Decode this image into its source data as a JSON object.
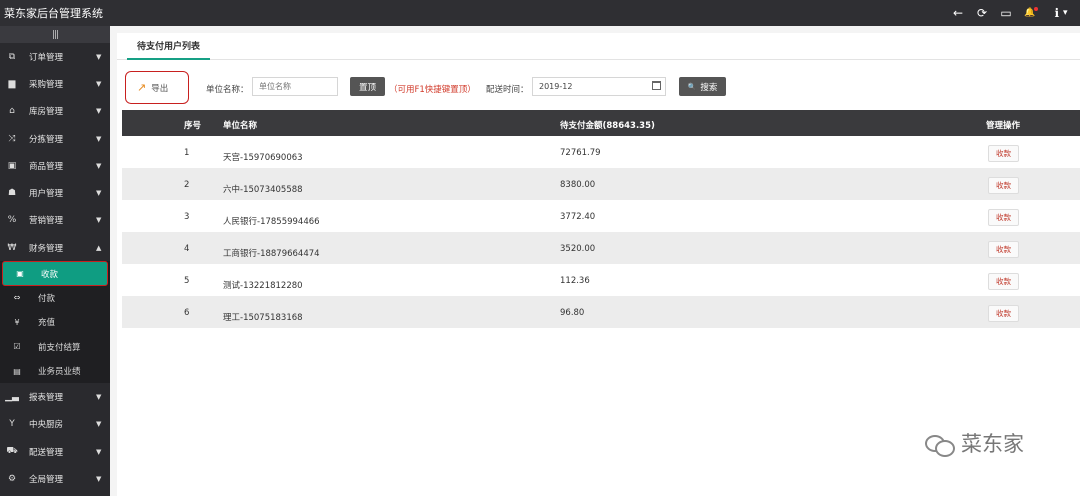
{
  "app": {
    "title": "菜东家后台管理系统"
  },
  "topbar": {
    "icons": [
      "arrow-left-icon",
      "refresh-icon",
      "monitor-icon",
      "bell-icon",
      "info-icon"
    ],
    "glyphs": {
      "back": "←",
      "refresh": "⟳",
      "monitor": "▭",
      "bell": "🔔",
      "info": "ℹ",
      "caret": "▾"
    }
  },
  "sidebar": {
    "toggle": "|||",
    "items": [
      {
        "icon": "copy-icon",
        "glyph": "⧉",
        "label": "订单管理"
      },
      {
        "icon": "basket-icon",
        "glyph": "▆",
        "label": "采购管理"
      },
      {
        "icon": "bank-icon",
        "glyph": "⌂",
        "label": "库房管理"
      },
      {
        "icon": "shuffle-icon",
        "glyph": "⤨",
        "label": "分拣管理"
      },
      {
        "icon": "store-icon",
        "glyph": "▣",
        "label": "商品管理"
      },
      {
        "icon": "users-icon",
        "glyph": "☗",
        "label": "用户管理"
      },
      {
        "icon": "percent-icon",
        "glyph": "%",
        "label": "营销管理"
      },
      {
        "icon": "won-icon",
        "glyph": "₩",
        "label": "财务管理"
      }
    ],
    "finance_sub": [
      {
        "icon": "money-icon",
        "glyph": "▣",
        "label": "收款"
      },
      {
        "icon": "exchange-icon",
        "glyph": "⇔",
        "label": "付款"
      },
      {
        "icon": "yen-icon",
        "glyph": "¥",
        "label": "充值"
      },
      {
        "icon": "check-square-icon",
        "glyph": "☑",
        "label": "前支付结算"
      },
      {
        "icon": "file-icon",
        "glyph": "▤",
        "label": "业务员业绩"
      }
    ],
    "items_after": [
      {
        "icon": "chart-icon",
        "glyph": "▁▃",
        "label": "报表管理"
      },
      {
        "icon": "filter-icon",
        "glyph": "Y",
        "label": "中央厨房"
      },
      {
        "icon": "car-icon",
        "glyph": "⛟",
        "label": "配送管理"
      },
      {
        "icon": "cogs-icon",
        "glyph": "⚙",
        "label": "全局管理"
      }
    ]
  },
  "tab": {
    "label": "待支付用户列表"
  },
  "toolbar": {
    "export_glyph": "↗",
    "export_label": "导出",
    "unit_label": "单位名称：",
    "unit_placeholder": "单位名称",
    "reset_label": "置顶",
    "hint": "（可用F1快捷键置顶）",
    "date_label": "配送时间：",
    "date_value": "2019-12",
    "search_glyph": "🔍",
    "search_label": "搜索"
  },
  "table": {
    "headers": {
      "no": "序号",
      "name": "单位名称",
      "amount": "待支付金额(88643.35)",
      "op": "管理操作"
    },
    "rows": [
      {
        "no": "1",
        "name": "天宫-15970690063",
        "amount": "72761.79",
        "action": "收款"
      },
      {
        "no": "2",
        "name": "六中-15073405588",
        "amount": "8380.00",
        "action": "收款"
      },
      {
        "no": "3",
        "name": "人民银行-17855994466",
        "amount": "3772.40",
        "action": "收款"
      },
      {
        "no": "4",
        "name": "工商银行-18879664474",
        "amount": "3520.00",
        "action": "收款"
      },
      {
        "no": "5",
        "name": "测试-13221812280",
        "amount": "112.36",
        "action": "收款"
      },
      {
        "no": "6",
        "name": "理工-15075183168",
        "amount": "96.80",
        "action": "收款"
      }
    ]
  },
  "watermark": {
    "text": "菜东家"
  }
}
